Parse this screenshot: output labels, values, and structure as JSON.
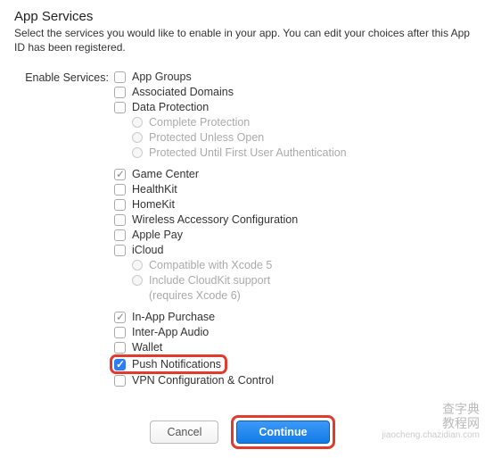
{
  "header": {
    "title": "App Services",
    "subtitle": "Select the services you would like to enable in your app. You can edit your choices after this App ID has been registered."
  },
  "label": "Enable Services:",
  "services": {
    "app_groups": "App Groups",
    "associated_domains": "Associated Domains",
    "data_protection": "Data Protection",
    "dp_complete": "Complete Protection",
    "dp_unless_open": "Protected Unless Open",
    "dp_until_first_auth": "Protected Until First User Authentication",
    "game_center": "Game Center",
    "healthkit": "HealthKit",
    "homekit": "HomeKit",
    "wireless_accessory": "Wireless Accessory Configuration",
    "apple_pay": "Apple Pay",
    "icloud": "iCloud",
    "icloud_xcode5": "Compatible with Xcode 5",
    "icloud_cloudkit1": "Include CloudKit support",
    "icloud_cloudkit2": "(requires Xcode 6)",
    "in_app_purchase": "In-App Purchase",
    "inter_app_audio": "Inter-App Audio",
    "wallet": "Wallet",
    "push_notifications": "Push Notifications",
    "vpn_config": "VPN Configuration & Control"
  },
  "buttons": {
    "cancel": "Cancel",
    "continue": "Continue"
  },
  "watermark": {
    "line1": "查字典",
    "line2": "教程网",
    "sub": "jiaocheng.chazidian.com"
  }
}
